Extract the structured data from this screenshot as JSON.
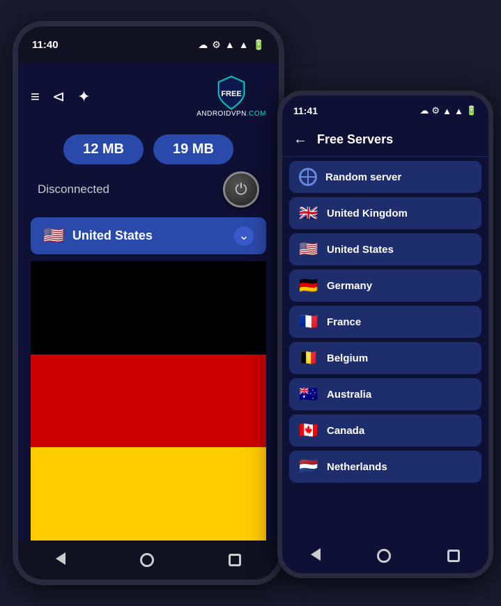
{
  "phone1": {
    "status_bar": {
      "time": "11:40",
      "icons": [
        "☁",
        "▲"
      ]
    },
    "toolbar": {
      "menu_icon": "≡",
      "share_icon": "⊲",
      "rate_icon": "★"
    },
    "logo": {
      "text_part1": "FREE",
      "text_part2": "ANDROIDVPN",
      "text_part3": ".COM"
    },
    "stat_left": "12 MB",
    "stat_right": "19 MB",
    "connection_status": "Disconnected",
    "country_label": "United States",
    "country_flag": "🇺🇸",
    "flag_description": "Germany flag"
  },
  "phone2": {
    "status_bar": {
      "time": "11:41",
      "icons": [
        "☁",
        "▲"
      ]
    },
    "header_title": "Free Servers",
    "back_label": "←",
    "servers": [
      {
        "name": "Random server",
        "flag": "🌐",
        "is_globe": true
      },
      {
        "name": "United Kingdom",
        "flag": "🇬🇧"
      },
      {
        "name": "United States",
        "flag": "🇺🇸"
      },
      {
        "name": "Germany",
        "flag": "🇩🇪"
      },
      {
        "name": "France",
        "flag": "🇫🇷"
      },
      {
        "name": "Belgium",
        "flag": "🇧🇪"
      },
      {
        "name": "Australia",
        "flag": "🇦🇺"
      },
      {
        "name": "Canada",
        "flag": "🇨🇦"
      },
      {
        "name": "Netherlands",
        "flag": "🇳🇱"
      }
    ]
  }
}
